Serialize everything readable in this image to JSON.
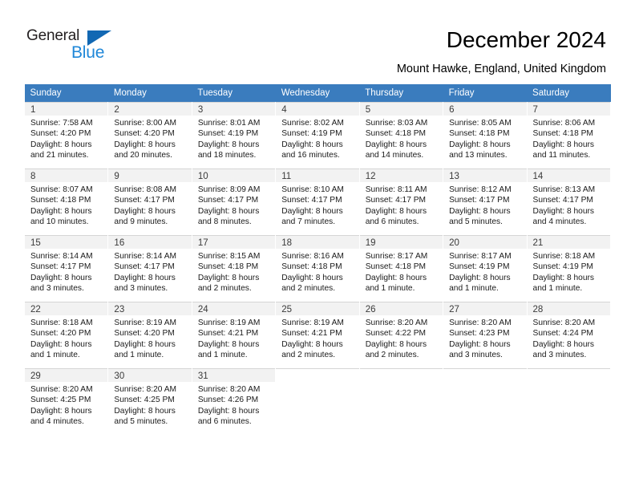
{
  "brand": {
    "name_top": "General",
    "name_bottom": "Blue",
    "triangle_color": "#1268b3",
    "blue_color": "#1f87d8"
  },
  "header": {
    "title": "December 2024",
    "subtitle": "Mount Hawke, England, United Kingdom"
  },
  "theme": {
    "header_row_bg": "#3a7cbe",
    "header_row_text": "#ffffff",
    "cell_shade": "#f2f2f2",
    "grid_line": "#d5d5d5"
  },
  "weekdays": [
    "Sunday",
    "Monday",
    "Tuesday",
    "Wednesday",
    "Thursday",
    "Friday",
    "Saturday"
  ],
  "weeks": [
    [
      {
        "day": "1",
        "sunrise": "Sunrise: 7:58 AM",
        "sunset": "Sunset: 4:20 PM",
        "daylight1": "Daylight: 8 hours",
        "daylight2": "and 21 minutes."
      },
      {
        "day": "2",
        "sunrise": "Sunrise: 8:00 AM",
        "sunset": "Sunset: 4:20 PM",
        "daylight1": "Daylight: 8 hours",
        "daylight2": "and 20 minutes."
      },
      {
        "day": "3",
        "sunrise": "Sunrise: 8:01 AM",
        "sunset": "Sunset: 4:19 PM",
        "daylight1": "Daylight: 8 hours",
        "daylight2": "and 18 minutes."
      },
      {
        "day": "4",
        "sunrise": "Sunrise: 8:02 AM",
        "sunset": "Sunset: 4:19 PM",
        "daylight1": "Daylight: 8 hours",
        "daylight2": "and 16 minutes."
      },
      {
        "day": "5",
        "sunrise": "Sunrise: 8:03 AM",
        "sunset": "Sunset: 4:18 PM",
        "daylight1": "Daylight: 8 hours",
        "daylight2": "and 14 minutes."
      },
      {
        "day": "6",
        "sunrise": "Sunrise: 8:05 AM",
        "sunset": "Sunset: 4:18 PM",
        "daylight1": "Daylight: 8 hours",
        "daylight2": "and 13 minutes."
      },
      {
        "day": "7",
        "sunrise": "Sunrise: 8:06 AM",
        "sunset": "Sunset: 4:18 PM",
        "daylight1": "Daylight: 8 hours",
        "daylight2": "and 11 minutes."
      }
    ],
    [
      {
        "day": "8",
        "sunrise": "Sunrise: 8:07 AM",
        "sunset": "Sunset: 4:18 PM",
        "daylight1": "Daylight: 8 hours",
        "daylight2": "and 10 minutes."
      },
      {
        "day": "9",
        "sunrise": "Sunrise: 8:08 AM",
        "sunset": "Sunset: 4:17 PM",
        "daylight1": "Daylight: 8 hours",
        "daylight2": "and 9 minutes."
      },
      {
        "day": "10",
        "sunrise": "Sunrise: 8:09 AM",
        "sunset": "Sunset: 4:17 PM",
        "daylight1": "Daylight: 8 hours",
        "daylight2": "and 8 minutes."
      },
      {
        "day": "11",
        "sunrise": "Sunrise: 8:10 AM",
        "sunset": "Sunset: 4:17 PM",
        "daylight1": "Daylight: 8 hours",
        "daylight2": "and 7 minutes."
      },
      {
        "day": "12",
        "sunrise": "Sunrise: 8:11 AM",
        "sunset": "Sunset: 4:17 PM",
        "daylight1": "Daylight: 8 hours",
        "daylight2": "and 6 minutes."
      },
      {
        "day": "13",
        "sunrise": "Sunrise: 8:12 AM",
        "sunset": "Sunset: 4:17 PM",
        "daylight1": "Daylight: 8 hours",
        "daylight2": "and 5 minutes."
      },
      {
        "day": "14",
        "sunrise": "Sunrise: 8:13 AM",
        "sunset": "Sunset: 4:17 PM",
        "daylight1": "Daylight: 8 hours",
        "daylight2": "and 4 minutes."
      }
    ],
    [
      {
        "day": "15",
        "sunrise": "Sunrise: 8:14 AM",
        "sunset": "Sunset: 4:17 PM",
        "daylight1": "Daylight: 8 hours",
        "daylight2": "and 3 minutes."
      },
      {
        "day": "16",
        "sunrise": "Sunrise: 8:14 AM",
        "sunset": "Sunset: 4:17 PM",
        "daylight1": "Daylight: 8 hours",
        "daylight2": "and 3 minutes."
      },
      {
        "day": "17",
        "sunrise": "Sunrise: 8:15 AM",
        "sunset": "Sunset: 4:18 PM",
        "daylight1": "Daylight: 8 hours",
        "daylight2": "and 2 minutes."
      },
      {
        "day": "18",
        "sunrise": "Sunrise: 8:16 AM",
        "sunset": "Sunset: 4:18 PM",
        "daylight1": "Daylight: 8 hours",
        "daylight2": "and 2 minutes."
      },
      {
        "day": "19",
        "sunrise": "Sunrise: 8:17 AM",
        "sunset": "Sunset: 4:18 PM",
        "daylight1": "Daylight: 8 hours",
        "daylight2": "and 1 minute."
      },
      {
        "day": "20",
        "sunrise": "Sunrise: 8:17 AM",
        "sunset": "Sunset: 4:19 PM",
        "daylight1": "Daylight: 8 hours",
        "daylight2": "and 1 minute."
      },
      {
        "day": "21",
        "sunrise": "Sunrise: 8:18 AM",
        "sunset": "Sunset: 4:19 PM",
        "daylight1": "Daylight: 8 hours",
        "daylight2": "and 1 minute."
      }
    ],
    [
      {
        "day": "22",
        "sunrise": "Sunrise: 8:18 AM",
        "sunset": "Sunset: 4:20 PM",
        "daylight1": "Daylight: 8 hours",
        "daylight2": "and 1 minute."
      },
      {
        "day": "23",
        "sunrise": "Sunrise: 8:19 AM",
        "sunset": "Sunset: 4:20 PM",
        "daylight1": "Daylight: 8 hours",
        "daylight2": "and 1 minute."
      },
      {
        "day": "24",
        "sunrise": "Sunrise: 8:19 AM",
        "sunset": "Sunset: 4:21 PM",
        "daylight1": "Daylight: 8 hours",
        "daylight2": "and 1 minute."
      },
      {
        "day": "25",
        "sunrise": "Sunrise: 8:19 AM",
        "sunset": "Sunset: 4:21 PM",
        "daylight1": "Daylight: 8 hours",
        "daylight2": "and 2 minutes."
      },
      {
        "day": "26",
        "sunrise": "Sunrise: 8:20 AM",
        "sunset": "Sunset: 4:22 PM",
        "daylight1": "Daylight: 8 hours",
        "daylight2": "and 2 minutes."
      },
      {
        "day": "27",
        "sunrise": "Sunrise: 8:20 AM",
        "sunset": "Sunset: 4:23 PM",
        "daylight1": "Daylight: 8 hours",
        "daylight2": "and 3 minutes."
      },
      {
        "day": "28",
        "sunrise": "Sunrise: 8:20 AM",
        "sunset": "Sunset: 4:24 PM",
        "daylight1": "Daylight: 8 hours",
        "daylight2": "and 3 minutes."
      }
    ],
    [
      {
        "day": "29",
        "sunrise": "Sunrise: 8:20 AM",
        "sunset": "Sunset: 4:25 PM",
        "daylight1": "Daylight: 8 hours",
        "daylight2": "and 4 minutes."
      },
      {
        "day": "30",
        "sunrise": "Sunrise: 8:20 AM",
        "sunset": "Sunset: 4:25 PM",
        "daylight1": "Daylight: 8 hours",
        "daylight2": "and 5 minutes."
      },
      {
        "day": "31",
        "sunrise": "Sunrise: 8:20 AM",
        "sunset": "Sunset: 4:26 PM",
        "daylight1": "Daylight: 8 hours",
        "daylight2": "and 6 minutes."
      },
      {
        "day": "",
        "sunrise": "",
        "sunset": "",
        "daylight1": "",
        "daylight2": ""
      },
      {
        "day": "",
        "sunrise": "",
        "sunset": "",
        "daylight1": "",
        "daylight2": ""
      },
      {
        "day": "",
        "sunrise": "",
        "sunset": "",
        "daylight1": "",
        "daylight2": ""
      },
      {
        "day": "",
        "sunrise": "",
        "sunset": "",
        "daylight1": "",
        "daylight2": ""
      }
    ]
  ]
}
